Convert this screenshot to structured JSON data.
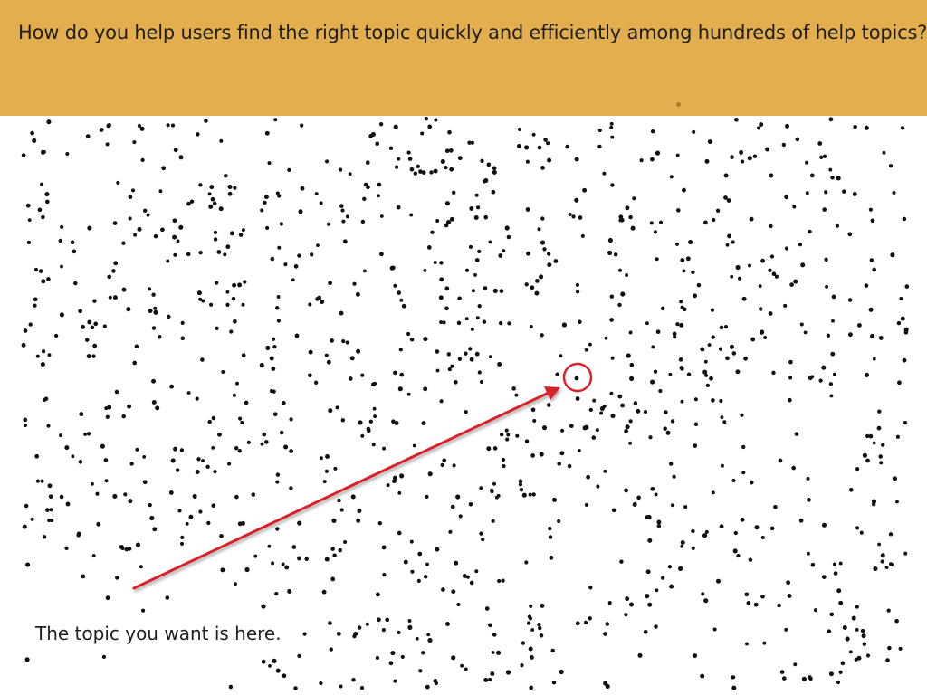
{
  "header": {
    "question": "How do you help users find the right topic quickly and efficiently among hundreds of help topics?",
    "background_color": "#e3ae4e"
  },
  "illustration": {
    "dot_color": "#111111",
    "arrow_color": "#d8232a",
    "target_circle_color": "#d8232a"
  },
  "caption": {
    "text": "The topic you want is here."
  }
}
